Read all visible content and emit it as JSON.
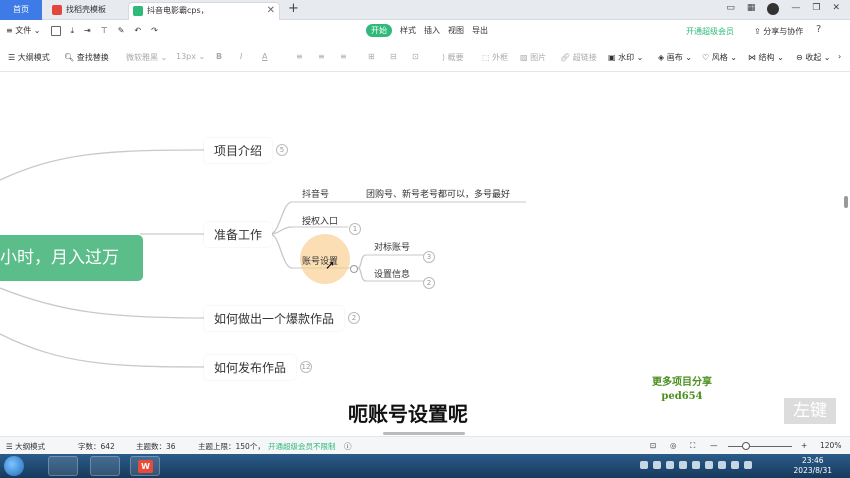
{
  "tabs": {
    "home": "首页",
    "tab1": "找稻壳模板",
    "tab2": "抖音电影霸cps，"
  },
  "menu": {
    "file": "文件",
    "items": [
      "开始",
      "样式",
      "插入",
      "视图",
      "导出"
    ],
    "vip": "开通超级会员",
    "share": "分享与协作",
    "help": "?"
  },
  "toolbar": {
    "outline": "大纲模式",
    "find": "查找替换",
    "font": "微软雅黑",
    "size": "13px",
    "bold": "B",
    "italic": "I",
    "color": "A",
    "summary": "概要",
    "frame": "外框",
    "image": "图片",
    "link": "超链接",
    "watermark": "水印",
    "canvas": "画布",
    "style": "风格",
    "structure": "结构",
    "collapse": "收起"
  },
  "mindmap": {
    "root": "小时，月入过万",
    "branches": [
      {
        "label": "项目介绍",
        "badge": "5"
      },
      {
        "label": "准备工作",
        "badge": ""
      },
      {
        "label": "如何做出一个爆款作品",
        "badge": "2"
      },
      {
        "label": "如何发布作品",
        "badge": "12"
      }
    ],
    "sub": {
      "douyin": "抖音号",
      "douyin_note": "团购号、新号老号都可以，多号最好",
      "auth": "授权入口",
      "auth_badge": "1",
      "account": "账号设置",
      "benchmark": "对标账号",
      "benchmark_badge": "3",
      "info": "设置信息",
      "info_badge": "2"
    }
  },
  "overlay": {
    "promo_line1": "更多项目分享",
    "promo_line2": "ped654",
    "subtitle": "呃账号设置呢",
    "key": "左键"
  },
  "status": {
    "outline": "大纲模式",
    "words": "字数：642",
    "topics": "主题数：36",
    "limit": "主题上限：150个，",
    "limit_link": "开通超级会员不限制",
    "minus": "—",
    "plus": "+",
    "zoom": "120%"
  },
  "taskbar": {
    "time": "23:46",
    "date": "2023/8/31",
    "wps": "W"
  }
}
